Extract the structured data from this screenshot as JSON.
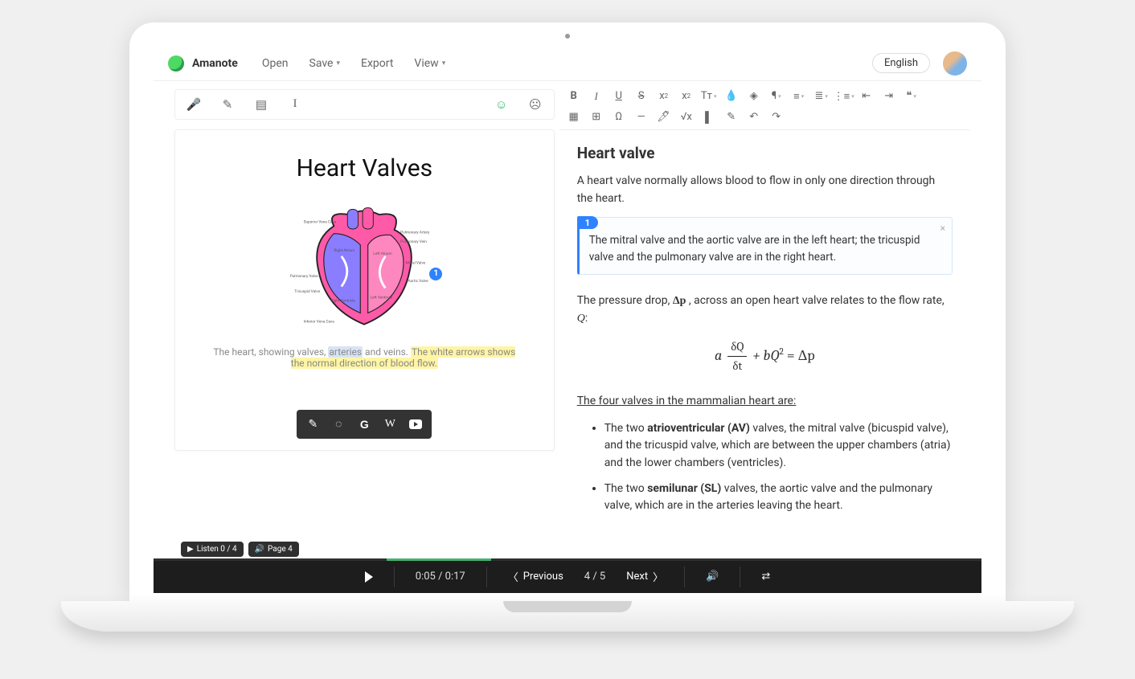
{
  "brand": "Amanote",
  "menubar": {
    "open": "Open",
    "save": "Save",
    "export": "Export",
    "view": "View"
  },
  "language": "English",
  "slide_toolbar": {
    "mic": "microphone",
    "draw": "pencil",
    "note": "sticky-note",
    "text": "text-cursor",
    "face_smile": "😊",
    "face_neutral": "😐"
  },
  "slide": {
    "title": "Heart Valves",
    "caption_pre": "The heart, showing valves, ",
    "caption_hl1": "arteries",
    "caption_mid": " and veins. ",
    "caption_hl2": "The white arrows shows the normal direction of blood flow.",
    "badge": "1"
  },
  "onslide_toolbar": {
    "pencil": "✎",
    "eraser": "⌫",
    "google": "G",
    "wikipedia": "W",
    "youtube": "▶"
  },
  "chips": {
    "listen": "Listen 0 / 4",
    "page": "Page 4"
  },
  "note": {
    "heading": "Heart valve",
    "intro": "A heart valve normally allows blood to flow in only one direction through the heart.",
    "box_badge": "1",
    "box_text": "The mitral valve and the aortic valve are in the left heart; the tricuspid valve and the pulmonary valve are in the right heart.",
    "pressure_pre": "The pressure drop, ",
    "pressure_sym": "Δp",
    "pressure_mid": " , across an open heart valve relates to the flow rate, ",
    "pressure_q": "Q",
    "pressure_post": ":",
    "eq": {
      "a": "a",
      "dQ": "δQ",
      "dt": "δt",
      "plus": "+ bQ",
      "sq": "2",
      "eq": " = Δp"
    },
    "subhead": "The four valves in the mammalian heart are:",
    "li1_pre": "The two ",
    "li1_bold": "atrioventricular (AV)",
    "li1_post": " valves, the mitral valve (bicuspid valve), and the tricuspid valve, which are between the upper chambers (atria) and the lower chambers (ventricles).",
    "li2_pre": "The two ",
    "li2_bold": "semilunar (SL)",
    "li2_post": " valves, the aortic valve and the pulmonary valve, which are in the arteries leaving the heart."
  },
  "playbar": {
    "time": "0:05 / 0:17",
    "prev": "Previous",
    "counter": "4 / 5",
    "next": "Next"
  }
}
